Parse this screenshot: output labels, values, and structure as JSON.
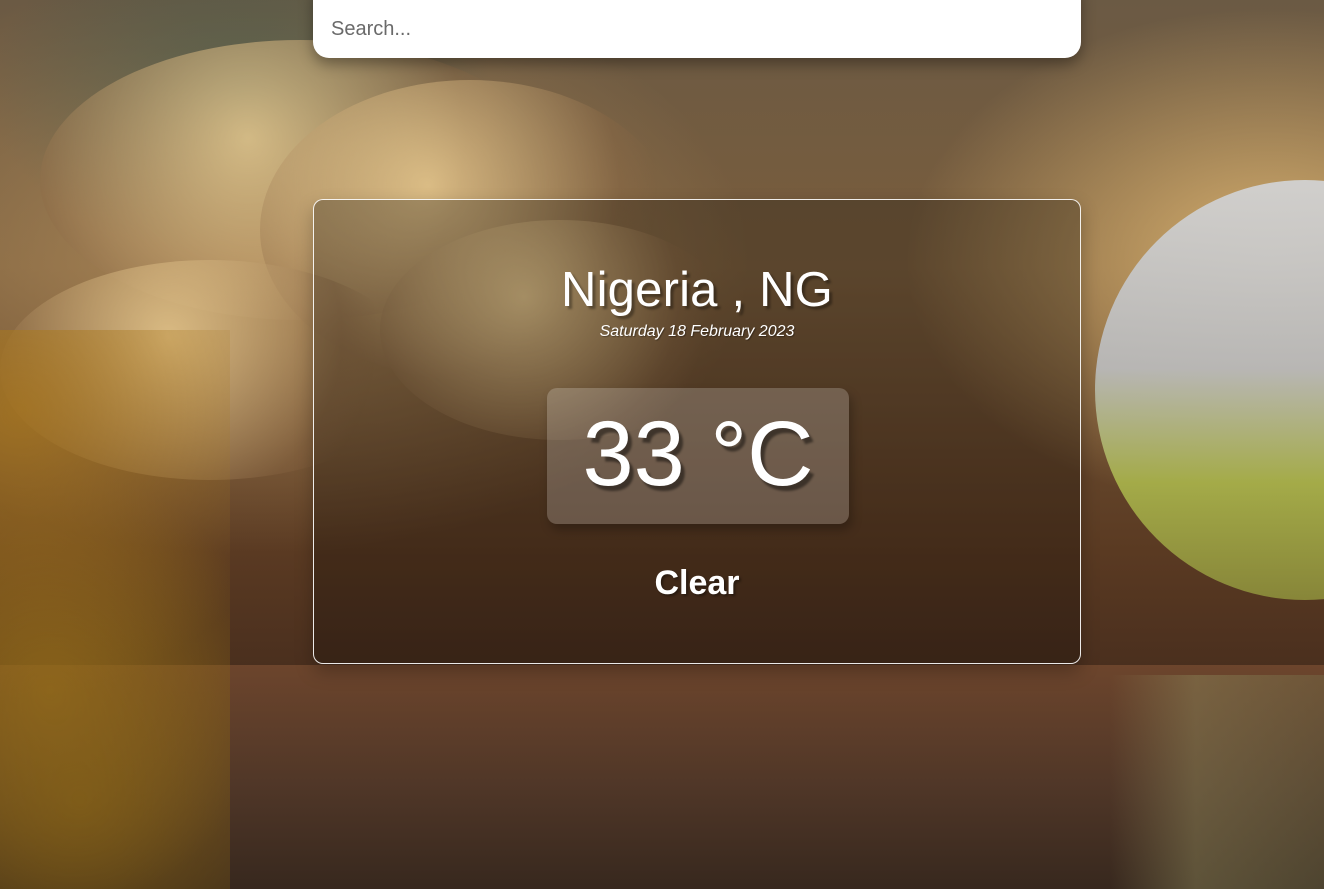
{
  "search": {
    "placeholder": "Search...",
    "value": ""
  },
  "weather": {
    "location": "Nigeria , NG",
    "date": "Saturday 18 February 2023",
    "temperature": "33 °C",
    "condition": "Clear"
  }
}
